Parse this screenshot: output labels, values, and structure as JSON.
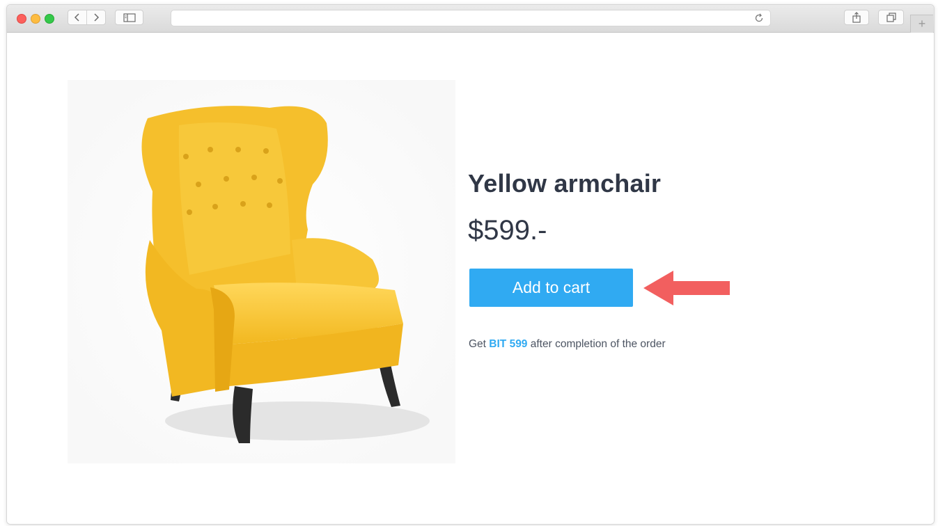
{
  "browser": {
    "url": "",
    "new_tab_label": "+"
  },
  "product": {
    "name": "Yellow armchair",
    "price": "$599.-",
    "add_to_cart_label": "Add to cart",
    "promo": {
      "prefix": "Get",
      "highlight": "BIT 599",
      "suffix": "after completion of the order"
    }
  },
  "colors": {
    "accent": "#30aaf2",
    "heading": "#303746",
    "annotation_arrow": "#f25f5f",
    "chair": "#f5bf2c"
  },
  "icons": {
    "back": "chevron-left-icon",
    "forward": "chevron-right-icon",
    "sidebar": "sidebar-icon",
    "reload": "reload-icon",
    "share": "share-icon",
    "tabs": "tabs-icon",
    "annotation": "arrow-left-icon"
  }
}
